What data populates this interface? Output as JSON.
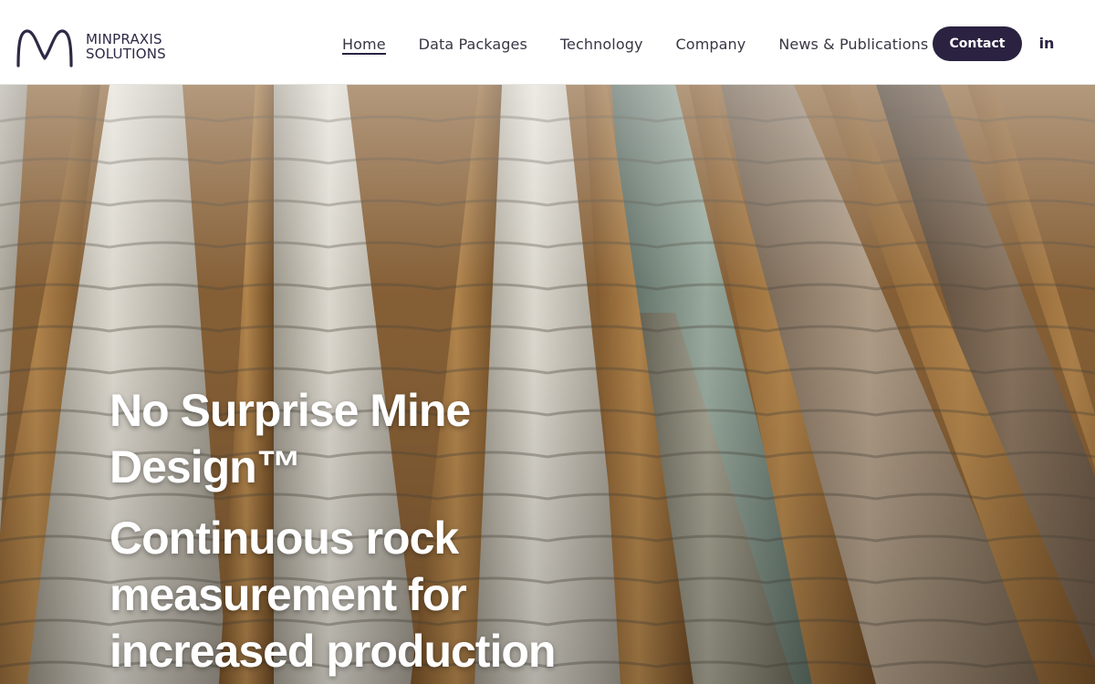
{
  "brand": {
    "name_line1": "MINPRAXIS",
    "name_line2": "SOLUTIONS",
    "logo_color": "#2d2a45"
  },
  "nav": {
    "items": [
      {
        "label": "Home",
        "active": true
      },
      {
        "label": "Data Packages",
        "active": false
      },
      {
        "label": "Technology",
        "active": false
      },
      {
        "label": "Company",
        "active": false
      },
      {
        "label": "News & Publications",
        "active": false
      }
    ],
    "contact_label": "Contact",
    "contact_color": "#2a2240",
    "social_icon": "linkedin-icon",
    "social_label": "in"
  },
  "hero": {
    "headline": "No Surprise Mine Design™",
    "subheadline": "Continuous rock measurement for increased production",
    "image": "drill-core-trays-photo"
  }
}
